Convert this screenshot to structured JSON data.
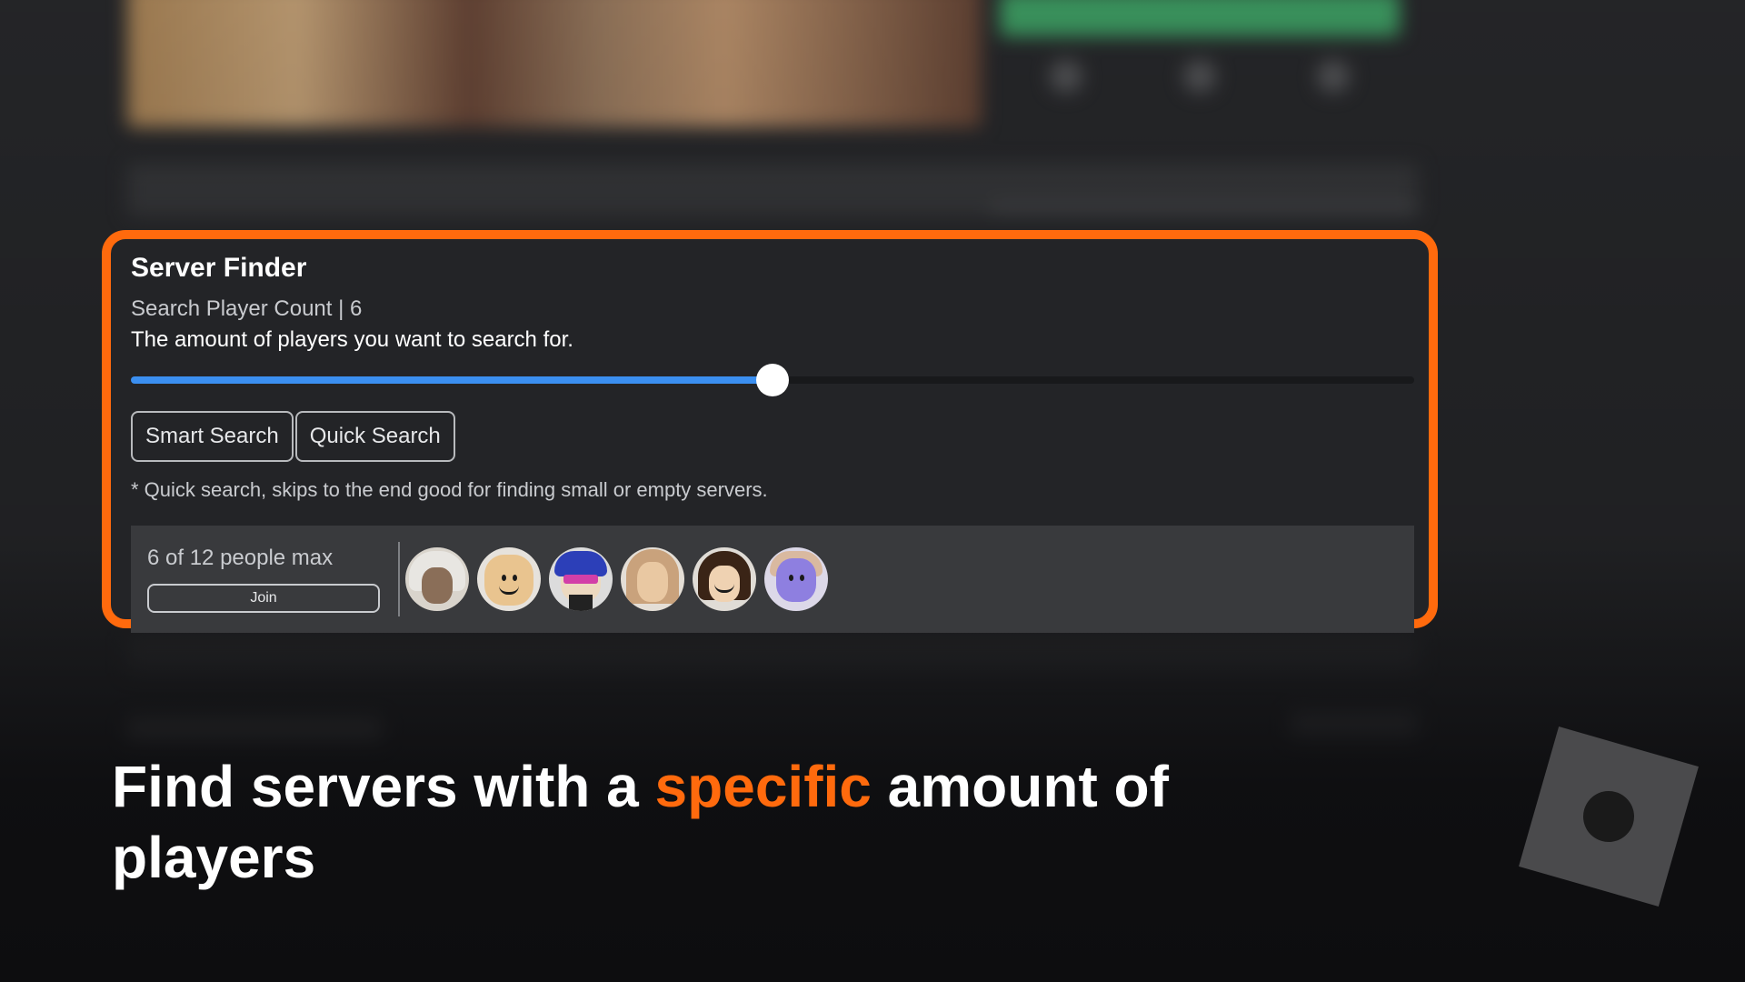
{
  "server_finder": {
    "title": "Server Finder",
    "player_count_label": "Search Player Count | 6",
    "description": "The amount of players you want to search for.",
    "slider": {
      "value": 6,
      "fraction": 0.5
    },
    "buttons": {
      "smart_search": "Smart Search",
      "quick_search": "Quick Search"
    },
    "note": "* Quick search, skips to the end good for finding small or empty servers.",
    "server": {
      "count_text": "6 of 12 people max",
      "join_label": "Join",
      "avatars": [
        "avatar-1",
        "avatar-2",
        "avatar-3",
        "avatar-4",
        "avatar-5",
        "avatar-6"
      ]
    }
  },
  "caption": {
    "part1": "Find servers with a ",
    "highlight": "specific",
    "part2": " amount of players"
  },
  "colors": {
    "accent_orange": "#ff6a0d",
    "slider_blue": "#3b8ff0",
    "panel_bg": "#232427"
  }
}
